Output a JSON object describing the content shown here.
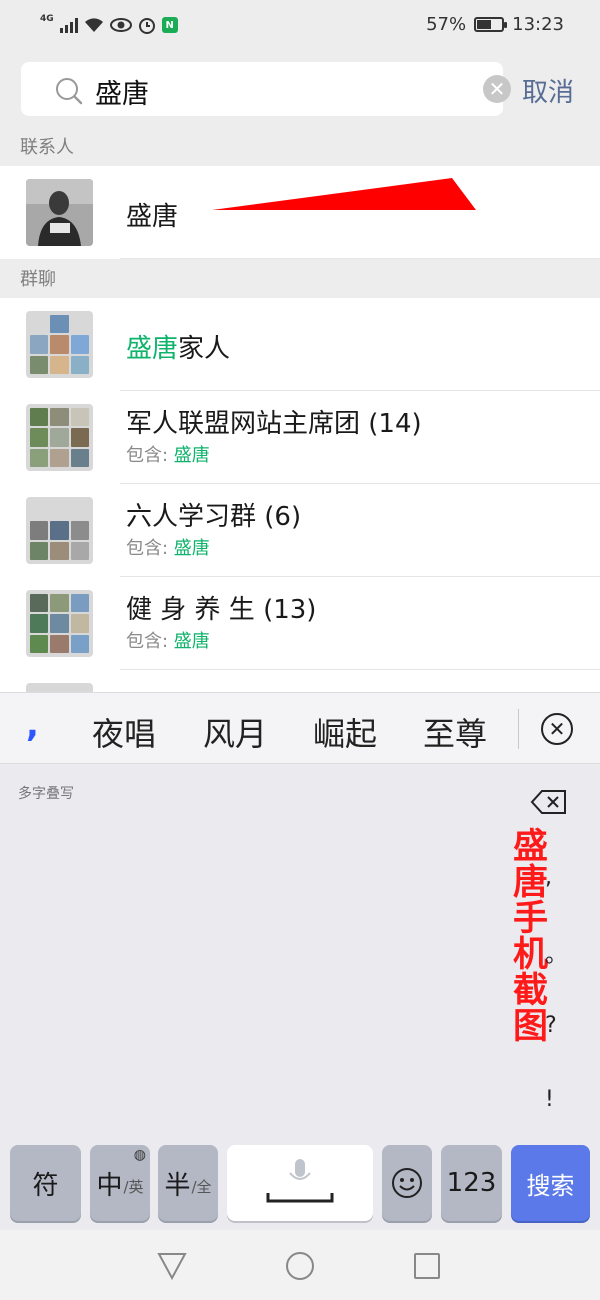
{
  "status_bar": {
    "network": "4G",
    "battery": "57%",
    "battery_level": 0.57,
    "time": "13:23"
  },
  "search": {
    "query": "盛唐",
    "cancel_label": "取消"
  },
  "sections": {
    "contacts": "联系人",
    "groups": "群聊"
  },
  "contacts": [
    {
      "name": "盛唐"
    }
  ],
  "groups": [
    {
      "name_match": "盛唐",
      "name_rest": "家人",
      "name": "",
      "count": "",
      "contains_label": "",
      "contains_match": ""
    },
    {
      "name_match": "",
      "name_rest": "",
      "name": "军人联盟网站主席团",
      "count": "(14)",
      "contains_label": "包含: ",
      "contains_match": "盛唐"
    },
    {
      "name_match": "",
      "name_rest": "",
      "name": "六人学习群",
      "count": "(6)",
      "contains_label": "包含: ",
      "contains_match": "盛唐"
    },
    {
      "name_match": "",
      "name_rest": "",
      "name": "健 身 养 生",
      "count": "(13)",
      "contains_label": "包含: ",
      "contains_match": "盛唐"
    }
  ],
  "keyboard": {
    "candidate_comma": ",",
    "candidates": [
      "夜唱",
      "风月",
      "崛起",
      "至尊"
    ],
    "hw_hint": "多字叠写",
    "keys": {
      "fu": "符",
      "zhong": "中",
      "zhong_sub": "/英",
      "ban": "半",
      "ban_sub": "/全",
      "num": "123",
      "search": "搜索"
    },
    "punctuation": [
      ",",
      "。",
      "?",
      "!"
    ]
  },
  "watermark": "盛唐手机截图",
  "colors": {
    "highlight_green": "#10b36b",
    "cancel_blue": "#586c94",
    "search_key": "#5b79e8",
    "watermark_red": "#ff1a1a"
  }
}
